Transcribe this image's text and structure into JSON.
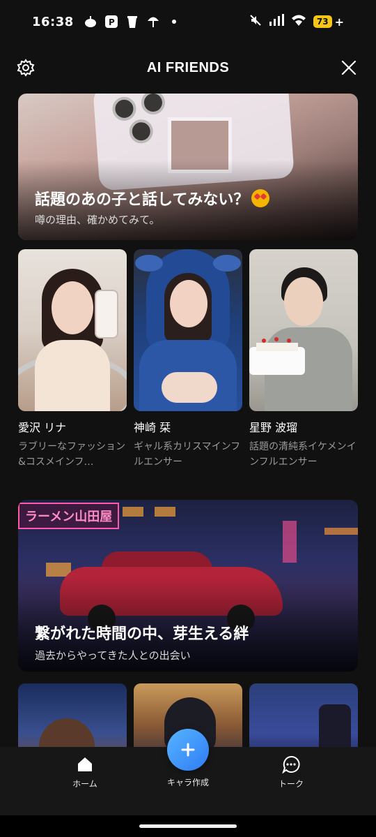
{
  "status_bar": {
    "time": "16:38",
    "battery": "73",
    "battery_suffix": "+",
    "icons": [
      "notification-app-icon",
      "notification-app-icon",
      "notification-app-icon",
      "notification-app-icon",
      "dot-icon",
      "mute-icon",
      "signal-icon",
      "wifi-icon",
      "battery-icon"
    ]
  },
  "header": {
    "title": "AI FRIENDS",
    "settings_icon": "gear-icon",
    "close_icon": "close-icon"
  },
  "banners": [
    {
      "title": "話題のあの子と話してみない？",
      "emoji": "star-struck-emoji",
      "subtitle": "噂の理由、確かめてみて。"
    },
    {
      "title": "繋がれた時間の中、芽生える絆",
      "subtitle": "過去からやってきた人との出会い",
      "sign_text": "ラーメン山田屋"
    }
  ],
  "characters": [
    {
      "name": "愛沢 リナ",
      "description": "ラブリーなファッション&コスメインフ…"
    },
    {
      "name": "神崎 栞",
      "description": "ギャル系カリスマインフルエンサー"
    },
    {
      "name": "星野 波瑠",
      "description": "話題の清純系イケメンインフルエンサー"
    }
  ],
  "bottom_nav": {
    "home_label": "ホーム",
    "create_label": "キャラ作成",
    "talk_label": "トーク",
    "accent": "#3b8cf7"
  }
}
